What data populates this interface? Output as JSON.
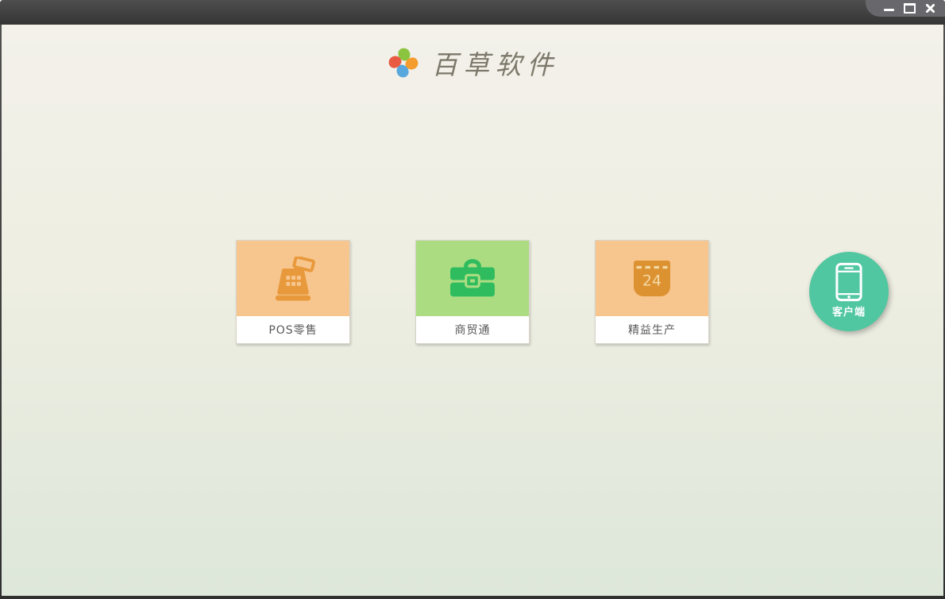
{
  "window": {
    "titlebar": {
      "controls": [
        {
          "name": "minimize",
          "glyph": "–"
        },
        {
          "name": "maximize",
          "glyph": "❐"
        },
        {
          "name": "close",
          "glyph": "✕"
        }
      ]
    }
  },
  "header": {
    "app_title": "百草软件",
    "logo_icon": "pinwheel-logo",
    "title_color": "#7c786a"
  },
  "products": [
    {
      "label": "POS零售",
      "icon": "cash-register-icon",
      "tile_color": "#f7c68e",
      "icon_color": "#e8993b"
    },
    {
      "label": "商贸通",
      "icon": "briefcase-icon",
      "tile_color": "#acdc81",
      "icon_color": "#2fbc5f"
    },
    {
      "label": "精益生产",
      "icon": "calendar-icon",
      "tile_color": "#f7c68e",
      "icon_color": "#dd9232",
      "calendar_day": "24"
    }
  ],
  "client_button": {
    "label": "客户端",
    "icon": "smartphone-icon",
    "color": "#50c7a0"
  },
  "theme": {
    "background_top": "#f3f1ea",
    "background_bottom": "#dde7da",
    "titlebar_color": "#424242",
    "controls_panel_color": "#67676c"
  }
}
